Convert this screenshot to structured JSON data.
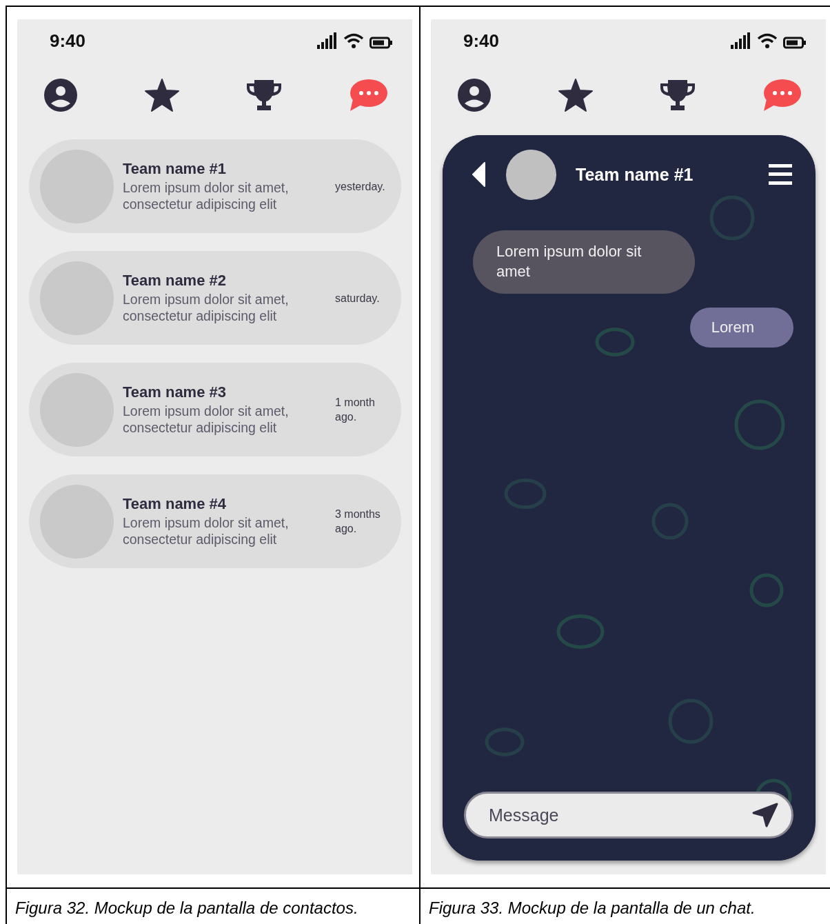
{
  "contacts_screen": {
    "status_bar": {
      "time": "9:40"
    },
    "nav": [
      {
        "kind": "profile",
        "selected": false
      },
      {
        "kind": "star",
        "selected": false
      },
      {
        "kind": "trophy",
        "selected": false
      },
      {
        "kind": "chat",
        "selected": true
      }
    ],
    "contacts": [
      {
        "name": "Team name #1",
        "preview": "Lorem ipsum dolor sit amet, consectetur adipiscing elit",
        "time": "yesterday."
      },
      {
        "name": "Team name #2",
        "preview": "Lorem ipsum dolor sit amet, consectetur adipiscing elit",
        "time": "saturday."
      },
      {
        "name": "Team name #3",
        "preview": "Lorem ipsum dolor sit amet, consectetur adipiscing elit",
        "time": "1 month ago."
      },
      {
        "name": "Team name #4",
        "preview": "Lorem ipsum dolor sit amet, consectetur adipiscing elit",
        "time": "3 months ago."
      }
    ]
  },
  "chat_screen": {
    "status_bar": {
      "time": "9:40"
    },
    "nav": [
      {
        "kind": "profile",
        "selected": false
      },
      {
        "kind": "star",
        "selected": false
      },
      {
        "kind": "trophy",
        "selected": false
      },
      {
        "kind": "chat",
        "selected": true
      }
    ],
    "header": {
      "title": "Team name #1"
    },
    "messages": [
      {
        "kind": "received",
        "text": "Lorem ipsum dolor sit amet"
      },
      {
        "kind": "sent",
        "text": "Lorem"
      }
    ],
    "input": {
      "placeholder": "Message"
    }
  },
  "captions": [
    "Figura 32. Mockup de la pantalla de contactos.",
    "Figura 33. Mockup de la pantalla de un chat."
  ]
}
